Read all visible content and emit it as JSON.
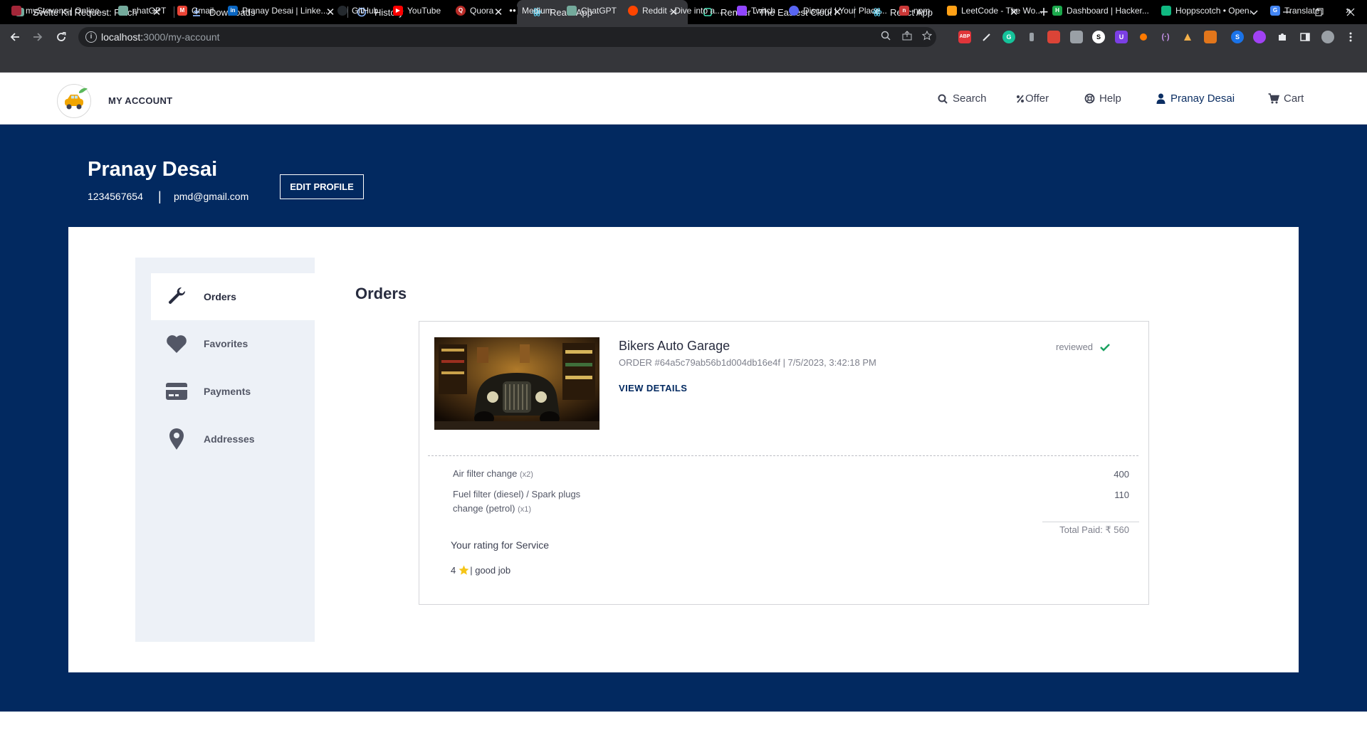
{
  "browser": {
    "tabs": [
      {
        "title": "Svelte Kit Request: Fetch",
        "icon": "chatgpt-icon",
        "active": false
      },
      {
        "title": "Downloads",
        "icon": "download-icon",
        "active": false
      },
      {
        "title": "History",
        "icon": "history-icon",
        "active": false
      },
      {
        "title": "React App",
        "icon": "react-icon",
        "active": true
      },
      {
        "title": "Render - The Easiest Cloud For Al",
        "icon": "render-icon",
        "active": false
      },
      {
        "title": "React App",
        "icon": "react-icon",
        "active": false
      }
    ],
    "close_glyph": "✕",
    "new_tab_glyph": "+",
    "url_host": "localhost:",
    "url_path": "3000/my-account",
    "bookmarks": [
      {
        "label": "myStevens | Online...",
        "color": "#a32638"
      },
      {
        "label": "chatGPT",
        "color": "#74aa9c"
      },
      {
        "label": "Gmail",
        "color": "#ea4335"
      },
      {
        "label": "Pranay Desai | Linke...",
        "color": "#0a66c2"
      },
      {
        "label": "GitHub",
        "color": "#24292e"
      },
      {
        "label": "YouTube",
        "color": "#ff0000"
      },
      {
        "label": "Quora",
        "color": "#b92b27"
      },
      {
        "label": "Medium",
        "color": "#000000"
      },
      {
        "label": "ChatGPT",
        "color": "#74aa9c"
      },
      {
        "label": "Reddit - Dive into a...",
        "color": "#ff4500"
      },
      {
        "label": "Twitch",
        "color": "#9146ff"
      },
      {
        "label": "Discord | Your Place...",
        "color": "#5865f2"
      },
      {
        "label": "npm",
        "color": "#cb3837"
      },
      {
        "label": "LeetCode - The Wo...",
        "color": "#ffa116"
      },
      {
        "label": "Dashboard | Hacker...",
        "color": "#1ba94c"
      },
      {
        "label": "Hoppscotch • Open...",
        "color": "#10b981"
      },
      {
        "label": "Translate",
        "color": "#4285f4"
      }
    ],
    "bookmarks_more": "»"
  },
  "header": {
    "brand": "MY ACCOUNT",
    "nav": {
      "search": "Search",
      "offer": "Offer",
      "help": "Help",
      "user": "Pranay Desai",
      "cart": "Cart"
    }
  },
  "profile": {
    "name": "Pranay Desai",
    "phone": "1234567654",
    "separator": "|",
    "email": "pmd@gmail.com",
    "edit_button": "EDIT PROFILE"
  },
  "sidebar": {
    "items": [
      {
        "label": "Orders",
        "icon": "wrench-icon",
        "active": true
      },
      {
        "label": "Favorites",
        "icon": "heart-icon",
        "active": false
      },
      {
        "label": "Payments",
        "icon": "credit-card-icon",
        "active": false
      },
      {
        "label": "Addresses",
        "icon": "map-pin-icon",
        "active": false
      }
    ]
  },
  "orders": {
    "title": "Orders",
    "order": {
      "shop": "Bikers Auto Garage",
      "meta": "ORDER #64a5c79ab56b1d004db16e4f | 7/5/2023, 3:42:18 PM",
      "view_details": "VIEW DETAILS",
      "status": "reviewed",
      "items": [
        {
          "name": "Air filter change",
          "qty": "(x2)",
          "price": "400"
        },
        {
          "name": "Fuel filter (diesel) / Spark plugs change (petrol)",
          "qty": "(x1)",
          "price": "110"
        }
      ],
      "total": "Total Paid: ₹ 560",
      "rating_label": "Your rating for Service",
      "rating_value": "4",
      "rating_comment": "| good job"
    }
  },
  "colors": {
    "band": "#022960",
    "accent": "#0b2e63",
    "check": "#1aa260"
  }
}
